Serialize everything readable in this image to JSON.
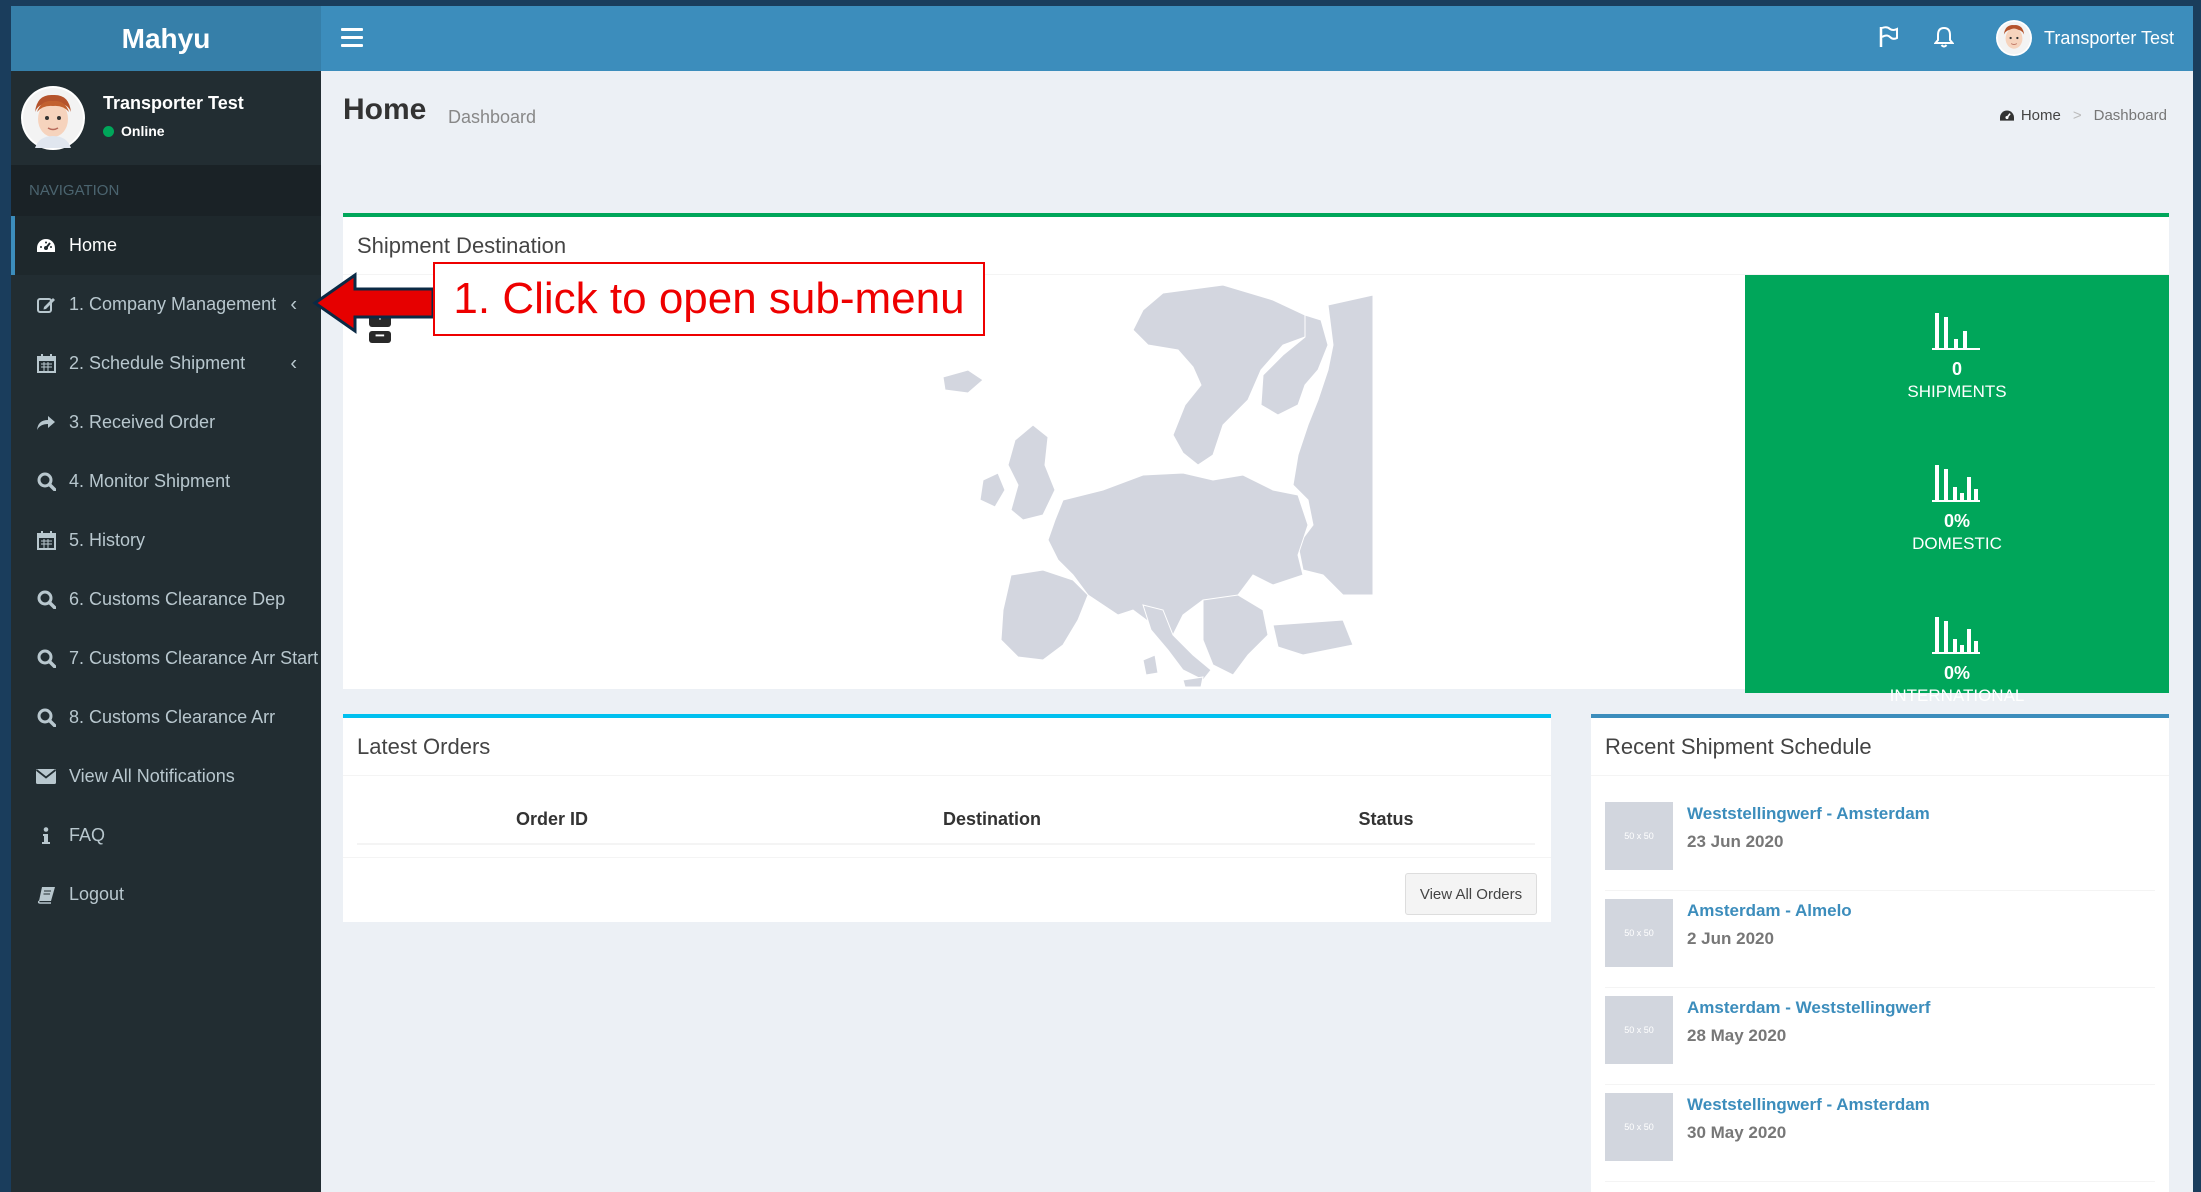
{
  "app": {
    "brand": "Mahyu"
  },
  "user": {
    "name": "Transporter Test",
    "status": "Online"
  },
  "sidebar": {
    "nav_header": "NAVIGATION",
    "items": [
      {
        "label": "Home",
        "icon": "dashboard-icon",
        "active": true
      },
      {
        "label": "1. Company Management",
        "icon": "edit-icon",
        "has_submenu": true
      },
      {
        "label": "2. Schedule Shipment",
        "icon": "calendar-icon",
        "has_submenu": true
      },
      {
        "label": "3. Received Order",
        "icon": "share-icon"
      },
      {
        "label": "4. Monitor Shipment",
        "icon": "search-icon"
      },
      {
        "label": "5. History",
        "icon": "calendar-icon"
      },
      {
        "label": "6. Customs Clearance Dep",
        "icon": "search-icon"
      },
      {
        "label": "7. Customs Clearance Arr Start",
        "icon": "search-icon"
      },
      {
        "label": "8. Customs Clearance Arr",
        "icon": "search-icon"
      },
      {
        "label": "View All Notifications",
        "icon": "envelope-icon"
      },
      {
        "label": "FAQ",
        "icon": "info-icon"
      },
      {
        "label": "Logout",
        "icon": "book-icon"
      }
    ]
  },
  "header": {
    "user_name": "Transporter Test"
  },
  "page": {
    "title": "Home",
    "subtitle": "Dashboard"
  },
  "breadcrumb": {
    "home": "Home",
    "current": "Dashboard"
  },
  "map_box": {
    "title": "Shipment Destination",
    "zoom_in": "+",
    "zoom_out": "−",
    "stats": [
      {
        "value": "0",
        "label": "SHIPMENTS"
      },
      {
        "value": "0%",
        "label": "DOMESTIC"
      },
      {
        "value": "0%",
        "label": "INTERNATIONAL"
      }
    ]
  },
  "orders_box": {
    "title": "Latest Orders",
    "columns": [
      "Order ID",
      "Destination",
      "Status"
    ],
    "rows": [],
    "view_all_label": "View All Orders"
  },
  "schedule_box": {
    "title": "Recent Shipment Schedule",
    "items": [
      {
        "title": "Weststellingwerf - Amsterdam",
        "date": "23 Jun 2020"
      },
      {
        "title": "Amsterdam - Almelo",
        "date": "2 Jun 2020"
      },
      {
        "title": "Amsterdam - Weststellingwerf",
        "date": "28 May 2020"
      },
      {
        "title": "Weststellingwerf - Amsterdam",
        "date": "30 May 2020"
      }
    ]
  },
  "annotation": {
    "text": "1. Click to open sub-menu"
  },
  "colors": {
    "sidebar_bg": "#222d32",
    "header_bg": "#3c8dbc",
    "logo_bg": "#367fa9",
    "stats_green": "#00a65a",
    "annotation_red": "#e00000"
  }
}
